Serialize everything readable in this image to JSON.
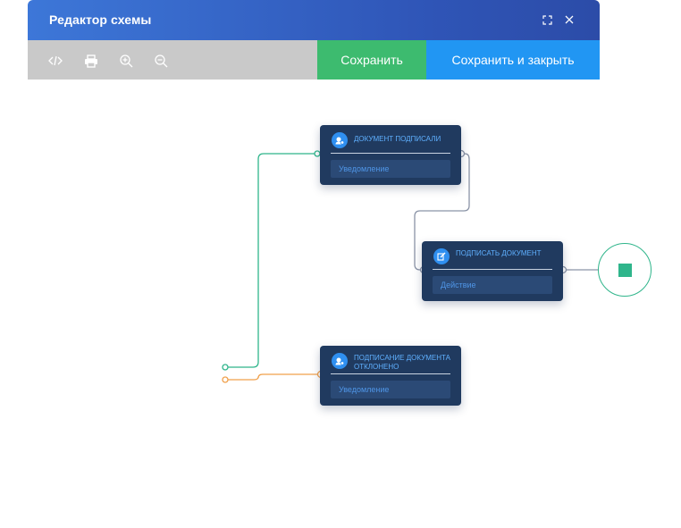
{
  "window": {
    "title": "Редактор схемы"
  },
  "toolbar": {
    "save_label": "Сохранить",
    "save_close_label": "Сохранить и закрыть",
    "icons": [
      "code-icon",
      "print-icon",
      "zoom-in-icon",
      "zoom-out-icon"
    ]
  },
  "nodes": [
    {
      "title": "ДОКУМЕНТ ПОДПИСАЛИ",
      "field": "Уведомление",
      "icon": "notification-icon"
    },
    {
      "title": "ПОДПИСАТЬ ДОКУМЕНТ",
      "field": "Действие",
      "icon": "edit-icon"
    },
    {
      "title": "ПОДПИСАНИЕ ДОКУМЕНТА ОТКЛОНЕНО",
      "field": "Уведомление",
      "icon": "notification-icon"
    }
  ],
  "colors": {
    "title_bar": "#2f55b7",
    "toolbar": "#c9c9c9",
    "save": "#3dbb6f",
    "save_close": "#2196f3",
    "node": "#203a5f",
    "link_green": "#2fb58b",
    "link_orange": "#f0a04b",
    "link_gray": "#8a93a6"
  }
}
